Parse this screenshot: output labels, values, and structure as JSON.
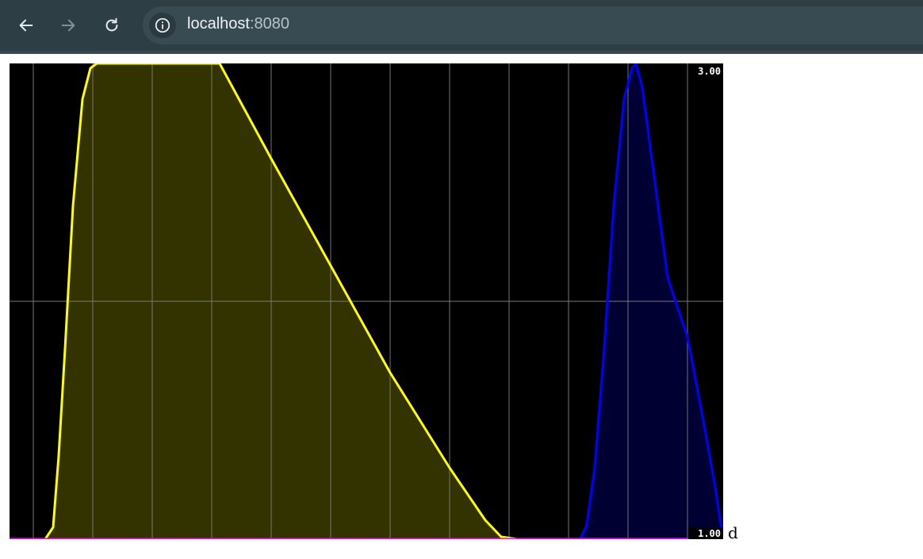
{
  "browser": {
    "url_host": "localhost",
    "url_port": ":8080",
    "icons": {
      "back": "back-arrow-icon",
      "forward": "forward-arrow-icon",
      "reload": "reload-icon",
      "info": "info-icon"
    }
  },
  "page": {
    "trailing_text": "d"
  },
  "chart_data": {
    "type": "area",
    "background": "#000000",
    "grid": true,
    "ylim": [
      1.0,
      3.0
    ],
    "y_tick_labels": [
      "3.00",
      "1.00"
    ],
    "x_positions": [
      0,
      30,
      105,
      180,
      255,
      330,
      405,
      480,
      555,
      630,
      705,
      780,
      855,
      900
    ],
    "series": [
      {
        "color": "#ffff00",
        "fill": "#333300",
        "points": [
          [
            0,
            1.0
          ],
          [
            45,
            1.0
          ],
          [
            55,
            1.05
          ],
          [
            62,
            1.35
          ],
          [
            70,
            1.8
          ],
          [
            80,
            2.4
          ],
          [
            92,
            2.85
          ],
          [
            102,
            2.98
          ],
          [
            110,
            3.0
          ],
          [
            265,
            3.0
          ],
          [
            330,
            2.6
          ],
          [
            405,
            2.15
          ],
          [
            480,
            1.7
          ],
          [
            555,
            1.3
          ],
          [
            600,
            1.08
          ],
          [
            620,
            1.01
          ],
          [
            640,
            1.0
          ],
          [
            900,
            1.0
          ]
        ]
      },
      {
        "color": "#0000ff",
        "fill": "#000033",
        "points": [
          [
            0,
            1.0
          ],
          [
            720,
            1.0
          ],
          [
            728,
            1.06
          ],
          [
            738,
            1.3
          ],
          [
            750,
            1.8
          ],
          [
            762,
            2.4
          ],
          [
            775,
            2.85
          ],
          [
            785,
            2.98
          ],
          [
            790,
            3.0
          ],
          [
            798,
            2.9
          ],
          [
            812,
            2.55
          ],
          [
            830,
            2.1
          ],
          [
            855,
            1.85
          ],
          [
            875,
            1.5
          ],
          [
            890,
            1.22
          ],
          [
            900,
            1.0
          ]
        ]
      },
      {
        "color": "#ff00ff",
        "fill": null,
        "points": [
          [
            0,
            1.0
          ],
          [
            900,
            1.0
          ]
        ]
      }
    ]
  }
}
